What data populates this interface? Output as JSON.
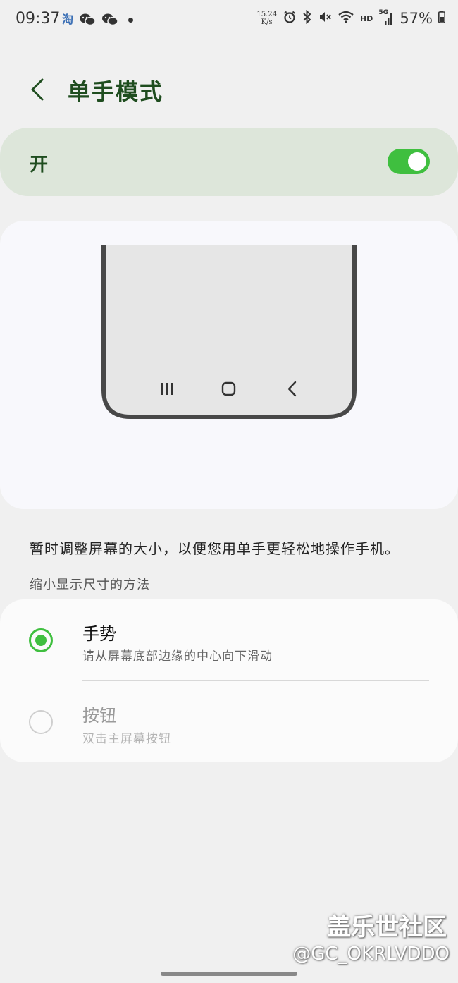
{
  "status_bar": {
    "time": "09:37",
    "left_icons": [
      "taobao-icon",
      "wechat-icon",
      "wechat-icon",
      "notification-dot-icon"
    ],
    "taobao_glyph": "淘",
    "net_speed_value": "15.24",
    "net_speed_unit": "K/s",
    "hd_label": "HD",
    "network_label": "5G",
    "battery": "57%"
  },
  "header": {
    "title": "单手模式",
    "back_icon": "chevron-left-icon"
  },
  "toggle": {
    "label": "开",
    "state": "on",
    "accent_color": "#3fbf3f"
  },
  "description": "暂时调整屏幕的大小，以便您用单手更轻松地操作手机。",
  "section_label": "缩小显示尺寸的方法",
  "options": [
    {
      "title": "手势",
      "subtitle": "请从屏幕底部边缘的中心向下滑动",
      "selected": true
    },
    {
      "title": "按钮",
      "subtitle": "双击主屏幕按钮",
      "selected": false
    }
  ],
  "watermark": {
    "brand": "盖乐世社区",
    "user": "@GC_OKRLVDDO"
  }
}
